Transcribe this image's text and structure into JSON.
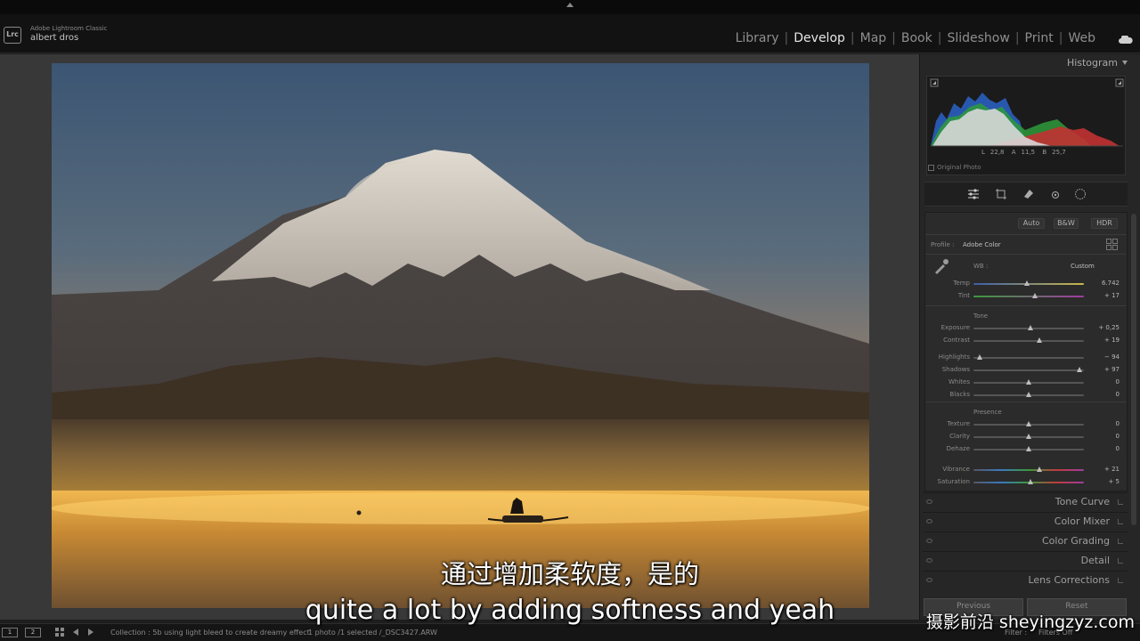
{
  "app": {
    "name": "Adobe Lightroom Classic",
    "logo_text": "Lrc",
    "user": "albert dros"
  },
  "modules": [
    "Library",
    "Develop",
    "Map",
    "Book",
    "Slideshow",
    "Print",
    "Web"
  ],
  "active_module": "Develop",
  "histogram": {
    "title": "Histogram",
    "values": {
      "l_label": "L",
      "l": "22,8",
      "a_label": "A",
      "a": "11,5",
      "b_label": "B",
      "b": "25,7"
    },
    "original_photo_label": "Original Photo"
  },
  "tools": [
    "edit-sliders-icon",
    "crop-icon",
    "healing-icon",
    "red-eye-icon",
    "masking-icon"
  ],
  "basic": {
    "treatment": [
      "Auto",
      "B&W",
      "HDR"
    ],
    "profile_label": "Profile :",
    "profile_value": "Adobe Color",
    "wb_label": "WB :",
    "wb_value": "Custom",
    "wb_sliders": [
      {
        "label": "Temp",
        "value": "6.742",
        "position": 0.48
      },
      {
        "label": "Tint",
        "value": "+ 17",
        "position": 0.56
      }
    ],
    "tone_label": "Tone",
    "tone_sliders": [
      {
        "label": "Exposure",
        "value": "+ 0,25",
        "position": 0.52
      },
      {
        "label": "Contrast",
        "value": "+ 19",
        "position": 0.6
      }
    ],
    "tone_sliders_2": [
      {
        "label": "Highlights",
        "value": "− 94",
        "position": 0.06
      },
      {
        "label": "Shadows",
        "value": "+ 97",
        "position": 0.96
      },
      {
        "label": "Whites",
        "value": "0",
        "position": 0.5
      },
      {
        "label": "Blacks",
        "value": "0",
        "position": 0.5
      }
    ],
    "presence_label": "Presence",
    "presence_sliders": [
      {
        "label": "Texture",
        "value": "0",
        "position": 0.5
      },
      {
        "label": "Clarity",
        "value": "0",
        "position": 0.5
      },
      {
        "label": "Dehaze",
        "value": "0",
        "position": 0.5
      }
    ],
    "presence_sliders_2": [
      {
        "label": "Vibrance",
        "value": "+ 21",
        "position": 0.6
      },
      {
        "label": "Saturation",
        "value": "+ 5",
        "position": 0.52
      }
    ]
  },
  "collapsed_panels": [
    "Tone Curve",
    "Color Mixer",
    "Color Grading",
    "Detail",
    "Lens Corrections"
  ],
  "buttons": {
    "previous": "Previous",
    "reset": "Reset"
  },
  "filmstrip": {
    "view_1": "1",
    "view_2": "2",
    "collection": "Collection : 5b using light bleed to create dreamy effect",
    "selection": "1 photo /1 selected /_DSC3427.ARW",
    "filter_label": "Filter :",
    "filter_value": "Filters Off"
  },
  "subtitles": {
    "chinese": "通过增加柔软度，是的",
    "english": "quite a lot by adding softness and yeah"
  },
  "watermark": "摄影前沿 sheyingzyz.com"
}
